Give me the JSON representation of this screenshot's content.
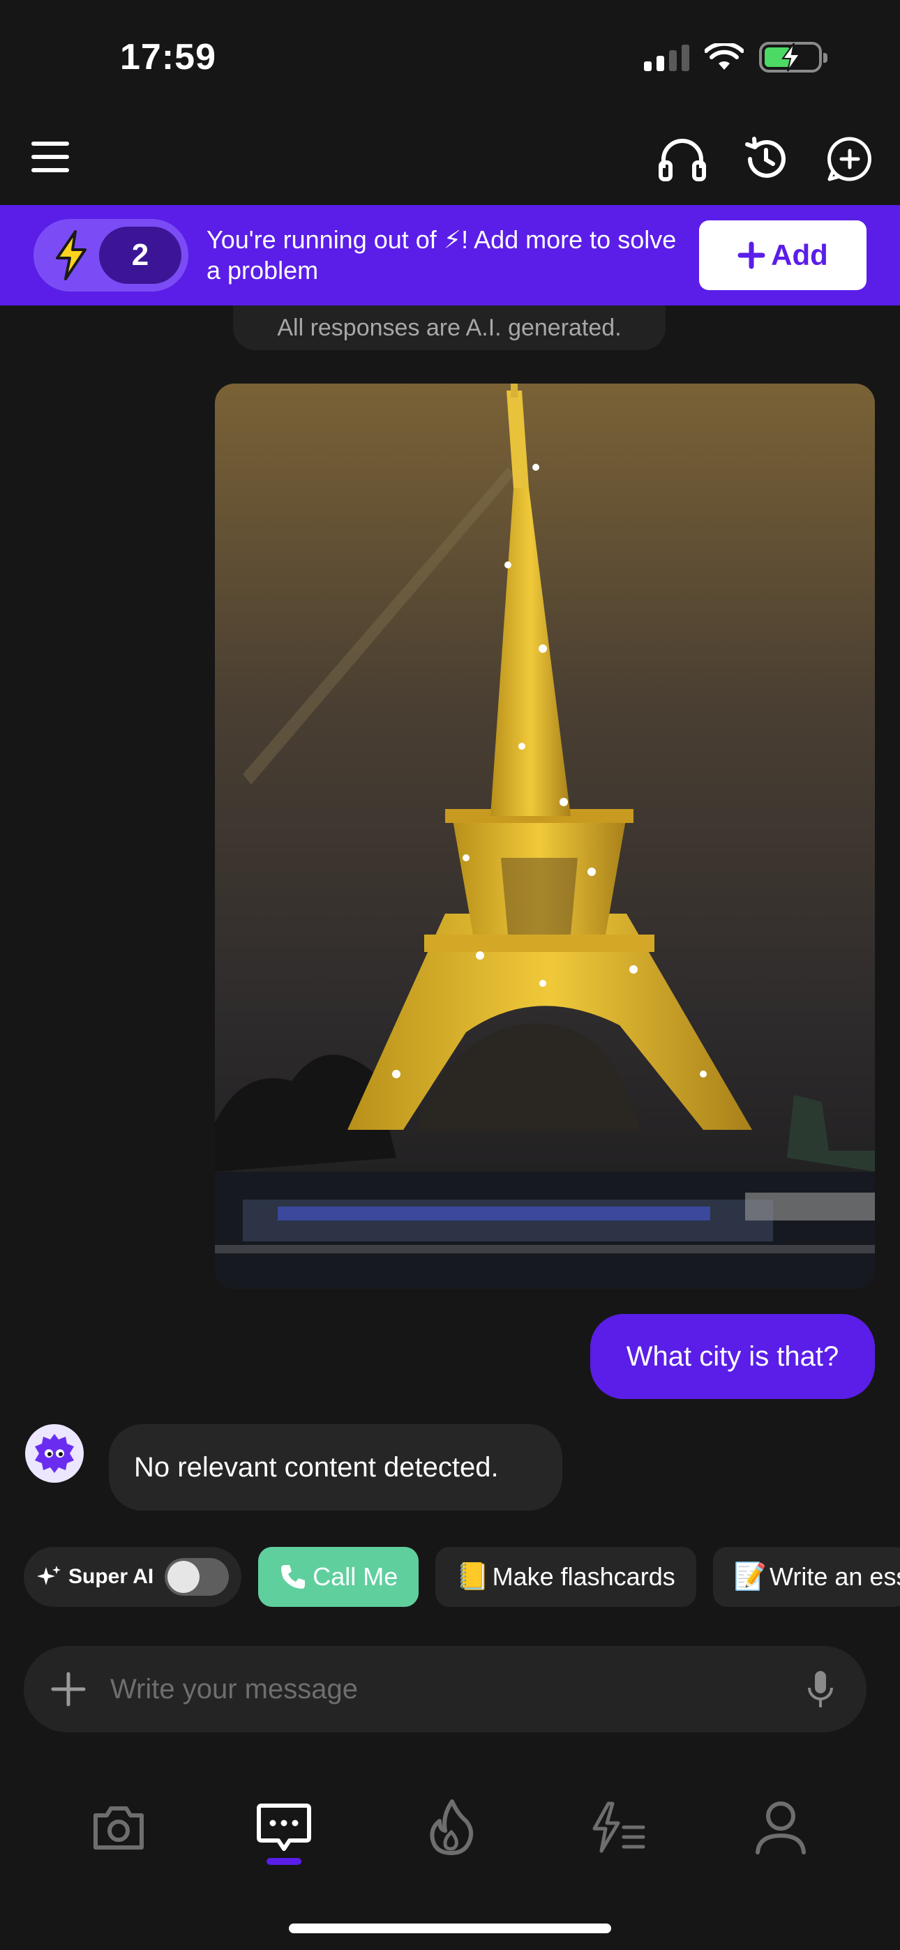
{
  "status_bar": {
    "time": "17:59"
  },
  "banner": {
    "credit_count": "2",
    "message": "You're running out of ⚡! Add more to solve a problem",
    "add_label": "Add",
    "color": "#5a1ee8"
  },
  "disclaimer": "All responses are A.I. generated.",
  "chat": {
    "user_message": "What city is that?",
    "bot_message": "No relevant content detected."
  },
  "chips": {
    "super_ai": "Super AI",
    "super_ai_enabled": false,
    "call_me": "Call Me",
    "flashcards": "Make flashcards",
    "flashcards_emoji": "📒",
    "essay": "Write an ess",
    "essay_emoji": "📝"
  },
  "input": {
    "placeholder": "Write your message"
  },
  "tabs": [
    {
      "icon": "camera-icon",
      "active": false
    },
    {
      "icon": "chat-icon",
      "active": true
    },
    {
      "icon": "fire-icon",
      "active": false
    },
    {
      "icon": "flash-list-icon",
      "active": false
    },
    {
      "icon": "profile-icon",
      "active": false
    }
  ],
  "colors": {
    "accent": "#5a1ee8",
    "call_green": "#5fcf9e",
    "background": "#161616"
  }
}
